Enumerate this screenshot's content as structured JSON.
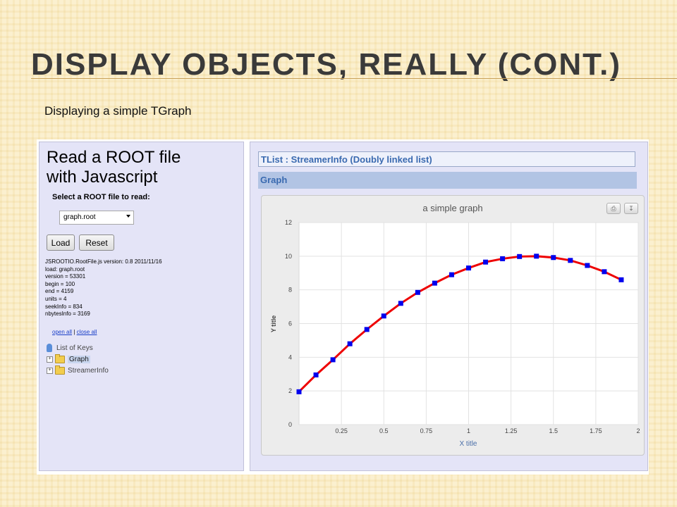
{
  "slide": {
    "title": "DISPLAY OBJECTS, REALLY (CONT.)",
    "subtitle": "Displaying a simple TGraph"
  },
  "left_panel": {
    "title_line1": "Read a ROOT file",
    "title_line2": "with Javascript",
    "select_label": "Select a ROOT file to read:",
    "file_select_value": "graph.root",
    "load_button": "Load",
    "reset_button": "Reset",
    "info_lines": [
      "JSROOTIO.RootFile.js version: 0.8 2011/11/16",
      "load: graph.root",
      "version = 53301",
      "begin = 100",
      "end = 4159",
      "units = 4",
      "seekInfo = 834",
      "nbytesInfo = 3169"
    ],
    "open_all": "open all",
    "separator": "|",
    "close_all": "close all",
    "tree_root": "List of Keys",
    "tree_items": [
      "Graph",
      "StreamerInfo"
    ],
    "tree_expander": "+"
  },
  "right_panel": {
    "tlist_label": "TList : StreamerInfo (Doubly linked list)",
    "graph_label": "Graph",
    "print_icon": "print-icon",
    "download_icon": "download-icon"
  },
  "chart_data": {
    "type": "line",
    "title": "a simple graph",
    "xlabel": "X title",
    "ylabel": "Y title",
    "xlim": [
      0,
      2
    ],
    "ylim": [
      0,
      12
    ],
    "xticks": [
      "0.25",
      "0.5",
      "0.75",
      "1",
      "1.25",
      "1.5",
      "1.75",
      "2"
    ],
    "xtick_values": [
      0.25,
      0.5,
      0.75,
      1,
      1.25,
      1.5,
      1.75,
      2
    ],
    "yticks": [
      "0",
      "2",
      "4",
      "6",
      "8",
      "10",
      "12"
    ],
    "ytick_values": [
      0,
      2,
      4,
      6,
      8,
      10,
      12
    ],
    "grid": true,
    "line_color": "#ee0000",
    "marker_color": "#0000ee",
    "series": [
      {
        "x": [
          0.0,
          0.1,
          0.2,
          0.3,
          0.4,
          0.5,
          0.6,
          0.7,
          0.8,
          0.9,
          1.0,
          1.1,
          1.2,
          1.3,
          1.4,
          1.5,
          1.6,
          1.7,
          1.8,
          1.9
        ],
        "y": [
          1.95,
          2.95,
          3.85,
          4.8,
          5.65,
          6.45,
          7.2,
          7.85,
          8.4,
          8.9,
          9.3,
          9.65,
          9.85,
          9.98,
          10.0,
          9.92,
          9.75,
          9.45,
          9.08,
          8.6
        ]
      }
    ]
  }
}
